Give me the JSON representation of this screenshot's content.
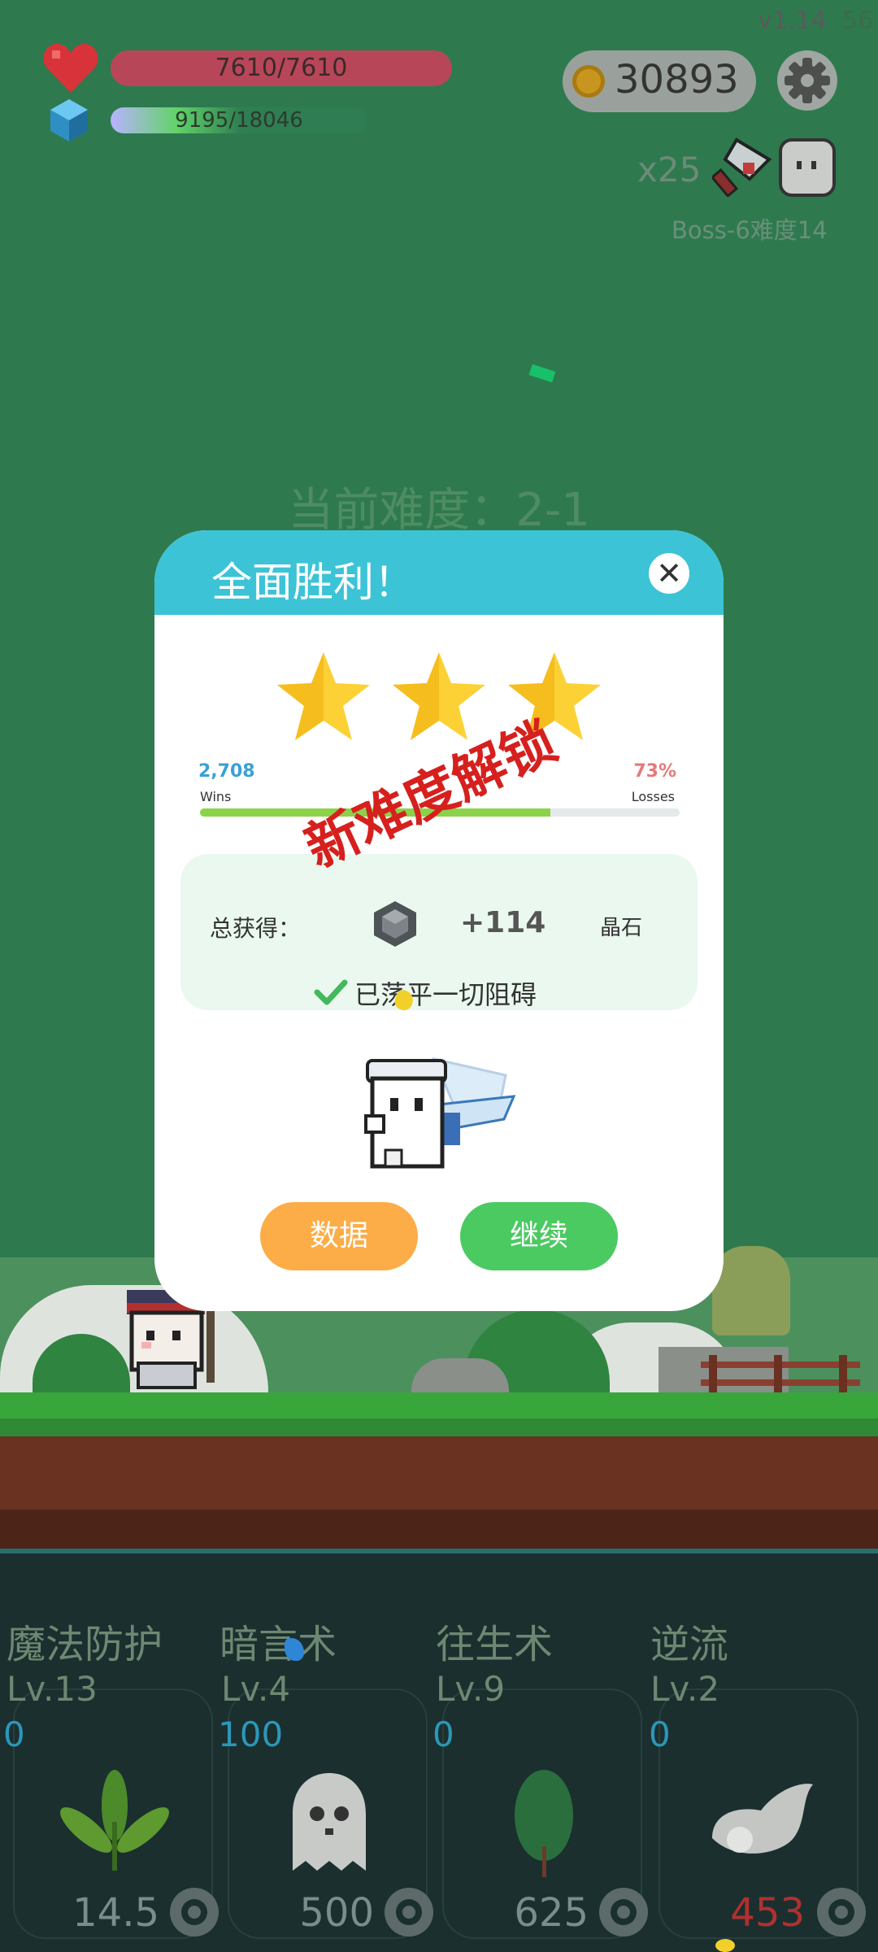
{
  "hud": {
    "version": "v1.14",
    "fps": "56",
    "hp_text": "7610/7610",
    "hp_fraction": 1.0,
    "xp_text": "9195/18046",
    "xp_fraction": 0.51,
    "coins": "30893",
    "multiplier": "x25",
    "boss_text": "Boss-6难度14",
    "difficulty_text": "当前难度：2-1",
    "colors": {
      "hp": "#b84659",
      "coin": "#c8961e",
      "background": "#2e7a4e"
    }
  },
  "dialog": {
    "title": "全面胜利！",
    "close_icon": "close-icon",
    "stars_earned": 3,
    "wins_value": "2,708",
    "wins_label": "Wins",
    "losses_value": "73%",
    "losses_label": "Losses",
    "win_fraction": 0.73,
    "unlock_stamp": "新难度解锁",
    "reward_label": "总获得：",
    "reward_amount": "+114",
    "reward_name": "晶石",
    "cleared_text": "已荡平一切阻碍",
    "data_button": "数据",
    "continue_button": "继续",
    "colors": {
      "header": "#3cc3d6",
      "data_button": "#fcad47",
      "continue_button": "#4cca62",
      "stamp": "#d6201e"
    }
  },
  "skills": [
    {
      "name": "魔法防护",
      "level": "Lv.13",
      "cost": "0",
      "upgrade_cost": "14.5",
      "icon": "leaves-icon",
      "affordable": true
    },
    {
      "name": "暗言术",
      "level": "Lv.4",
      "cost": "100",
      "upgrade_cost": "500",
      "icon": "ghost-icon",
      "affordable": true
    },
    {
      "name": "往生术",
      "level": "Lv.9",
      "cost": "0",
      "upgrade_cost": "625",
      "icon": "leaf-icon",
      "affordable": true
    },
    {
      "name": "逆流",
      "level": "Lv.2",
      "cost": "0",
      "upgrade_cost": "453",
      "icon": "wing-icon",
      "affordable": false
    }
  ]
}
